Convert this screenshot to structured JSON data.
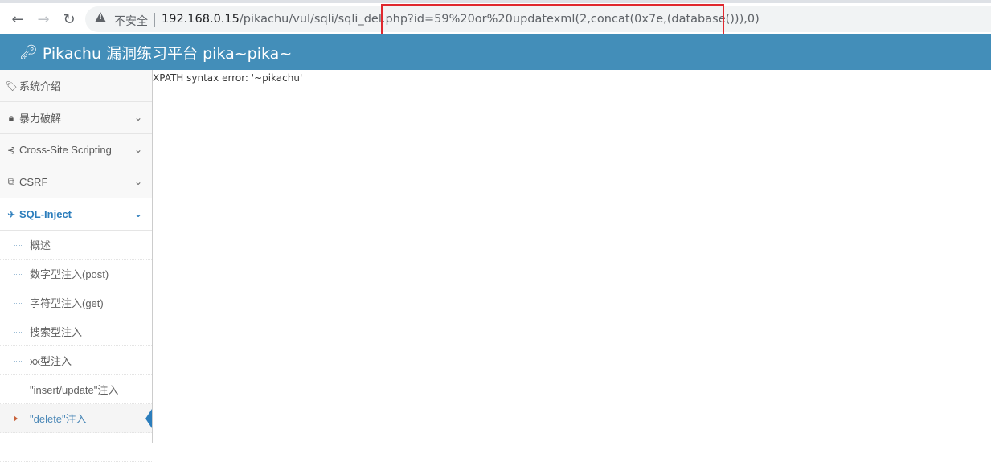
{
  "browser": {
    "back_icon": "arrow-left-icon",
    "forward_icon": "arrow-right-icon",
    "reload_icon": "reload-icon",
    "security_label": "不安全",
    "url_host": "192.168.0.15",
    "url_path": "/pikachu/vul/sqli/sqli_del.php?id=59%20or%20updatexml(2,concat(0x7e,(database())),0)",
    "highlight_color": "#e0282e"
  },
  "header": {
    "title": "Pikachu 漏洞练习平台 pika~pika~",
    "icon": "key-icon",
    "background": "#438eb9"
  },
  "sidebar": {
    "items": [
      {
        "label": "系统介绍",
        "icon": "tags-icon"
      },
      {
        "label": "暴力破解",
        "icon": "lock-icon"
      },
      {
        "label": "Cross-Site Scripting",
        "icon": "xss-icon"
      },
      {
        "label": "CSRF",
        "icon": "external-link-icon"
      },
      {
        "label": "SQL-Inject",
        "icon": "plane-icon"
      }
    ],
    "submenu": [
      {
        "label": "概述"
      },
      {
        "label": "数字型注入(post)"
      },
      {
        "label": "字符型注入(get)"
      },
      {
        "label": "搜索型注入"
      },
      {
        "label": "xx型注入"
      },
      {
        "label": "\"insert/update\"注入"
      },
      {
        "label": "\"delete\"注入"
      }
    ],
    "active_color": "#2b7dbc"
  },
  "main": {
    "error_message": "XPATH syntax error: '~pikachu'"
  }
}
